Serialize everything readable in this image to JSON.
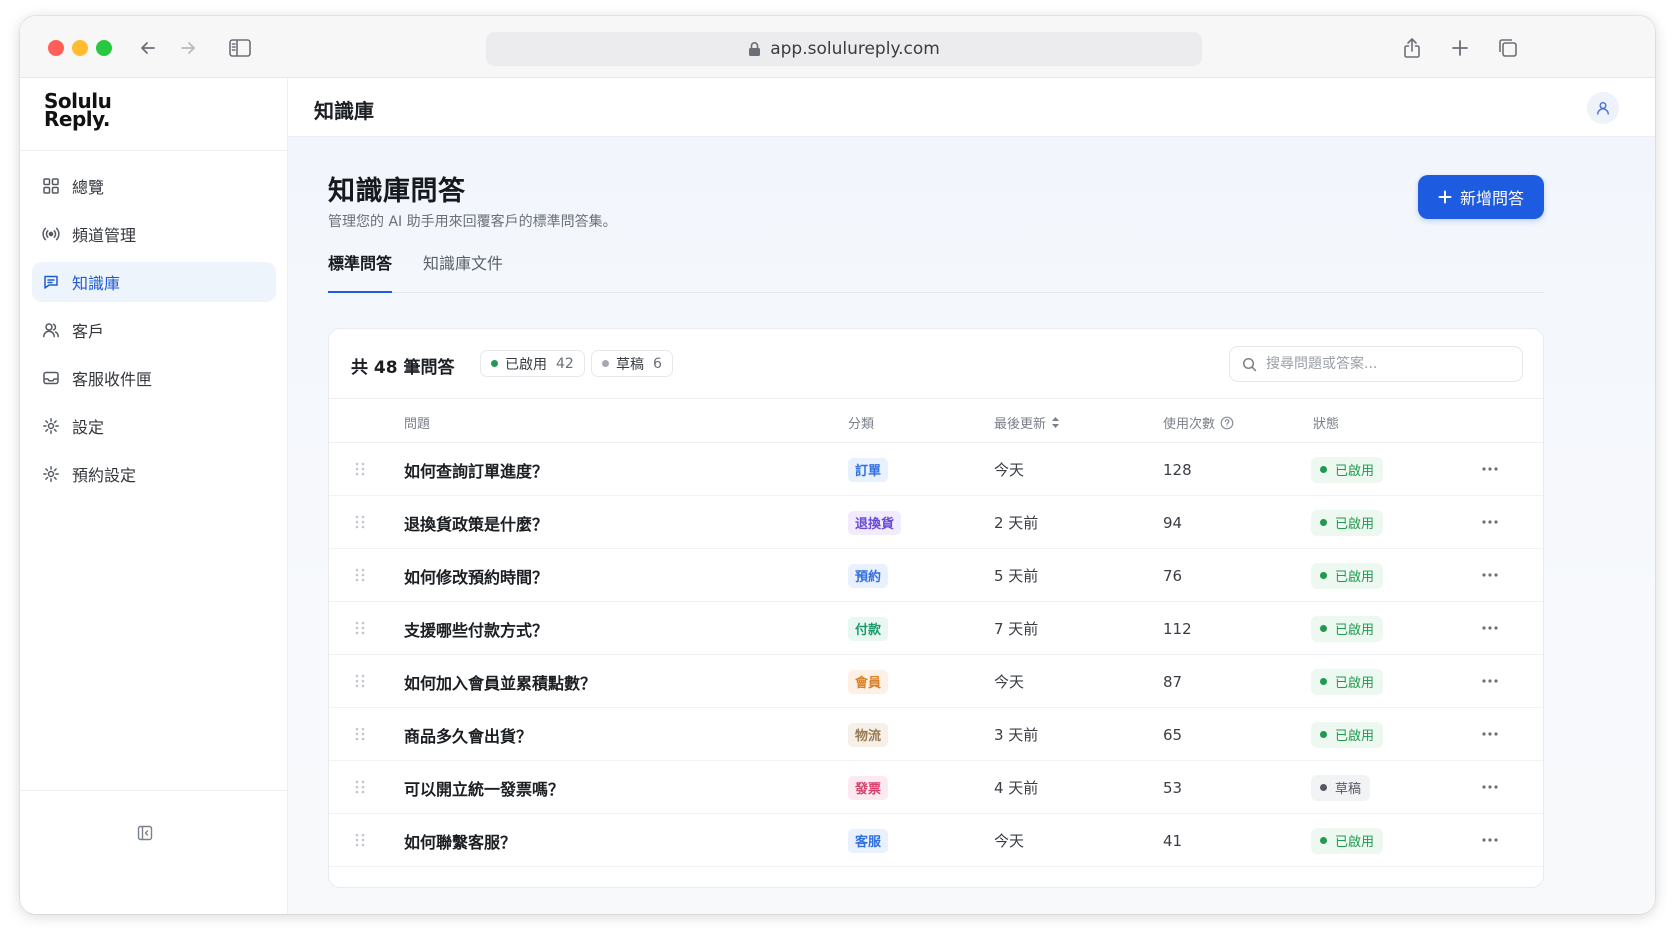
{
  "browser": {
    "url": "app.solulureply.com"
  },
  "brand": {
    "logo_line1": "Solulu",
    "logo_line2": "Reply."
  },
  "sidebar": {
    "items": [
      {
        "label": "總覽",
        "icon": "grid-icon",
        "active": false
      },
      {
        "label": "頻道管理",
        "icon": "broadcast-icon",
        "active": false
      },
      {
        "label": "知識庫",
        "icon": "message-square-icon",
        "active": true
      },
      {
        "label": "客戶",
        "icon": "users-icon",
        "active": false
      },
      {
        "label": "客服收件匣",
        "icon": "inbox-icon",
        "active": false
      },
      {
        "label": "設定",
        "icon": "gear-icon",
        "active": false
      },
      {
        "label": "預約設定",
        "icon": "gear-icon",
        "active": false
      }
    ]
  },
  "topbar": {
    "title": "知識庫"
  },
  "page": {
    "title": "知識庫問答",
    "subtitle": "管理您的 AI 助手用來回覆客戶的標準問答集。",
    "add_button": "新增問答",
    "tabs": [
      {
        "label": "標準問答",
        "active": true
      },
      {
        "label": "知識庫文件",
        "active": false
      }
    ]
  },
  "summary": {
    "total_label": "共 48 筆問答",
    "enabled_label": "已啟用",
    "enabled_count": "42",
    "draft_label": "草稿",
    "draft_count": "6"
  },
  "search": {
    "placeholder": "搜尋問題或答案..."
  },
  "table": {
    "headers": {
      "question": "問題",
      "category": "分類",
      "updated": "最後更新",
      "usage": "使用次數",
      "status": "狀態"
    },
    "rows": [
      {
        "question": "如何查詢訂單進度？",
        "category": "訂單",
        "cat_color": "#2f6fe0",
        "cat_bg": "#e9f1fe",
        "updated": "今天",
        "usage": "128",
        "status": "已啟用",
        "enabled": true
      },
      {
        "question": "退換貨政策是什麼？",
        "category": "退換貨",
        "cat_color": "#6a4bd6",
        "cat_bg": "#f0ecfd",
        "updated": "2 天前",
        "usage": "94",
        "status": "已啟用",
        "enabled": true
      },
      {
        "question": "如何修改預約時間？",
        "category": "預約",
        "cat_color": "#2f6fe0",
        "cat_bg": "#e9f1fe",
        "updated": "5 天前",
        "usage": "76",
        "status": "已啟用",
        "enabled": true
      },
      {
        "question": "支援哪些付款方式？",
        "category": "付款",
        "cat_color": "#1f9a6e",
        "cat_bg": "#e8f7f1",
        "updated": "7 天前",
        "usage": "112",
        "status": "已啟用",
        "enabled": true
      },
      {
        "question": "如何加入會員並累積點數？",
        "category": "會員",
        "cat_color": "#d9822b",
        "cat_bg": "#fdf1e6",
        "updated": "今天",
        "usage": "87",
        "status": "已啟用",
        "enabled": true
      },
      {
        "question": "商品多久會出貨？",
        "category": "物流",
        "cat_color": "#9a7a55",
        "cat_bg": "#f6f0e8",
        "updated": "3 天前",
        "usage": "65",
        "status": "已啟用",
        "enabled": true
      },
      {
        "question": "可以開立統一發票嗎？",
        "category": "發票",
        "cat_color": "#d83f6a",
        "cat_bg": "#fdeaf0",
        "updated": "4 天前",
        "usage": "53",
        "status": "草稿",
        "enabled": false
      },
      {
        "question": "如何聯繫客服？",
        "category": "客服",
        "cat_color": "#2f6fe0",
        "cat_bg": "#e9f1fe",
        "updated": "今天",
        "usage": "41",
        "status": "已啟用",
        "enabled": true
      }
    ]
  },
  "colors": {
    "accent": "#1d5be0",
    "enabled_green": "#1f9a4e",
    "enabled_bg": "#edf8f1",
    "draft_gray": "#555a62",
    "draft_bg": "#f2f3f5"
  }
}
